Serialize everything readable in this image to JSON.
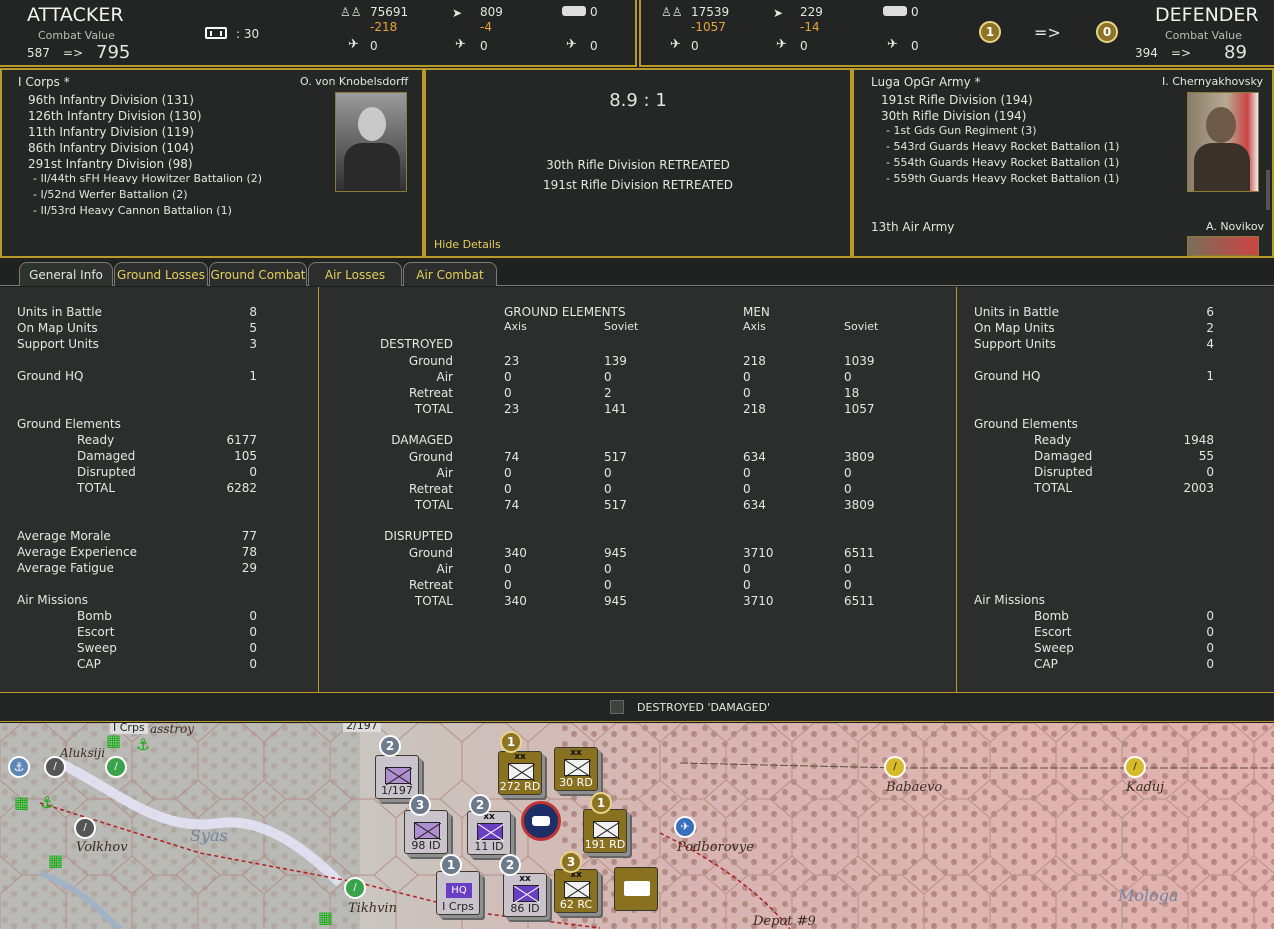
{
  "header": {
    "attacker_title": "ATTACKER",
    "attacker_cv_label": "Combat Value",
    "attacker_cv_from": "587",
    "attacker_cv_arrow": "=>",
    "attacker_cv_to": "795",
    "fort_value": ": 30",
    "att_men": "75691",
    "att_men_loss": "-218",
    "att_guns": "809",
    "att_guns_loss": "-4",
    "att_tanks": "0",
    "att_air1": "0",
    "att_air2": "0",
    "att_air3": "0",
    "def_men": "17539",
    "def_men_loss": "-1057",
    "def_guns": "229",
    "def_guns_loss": "-14",
    "def_tanks": "0",
    "def_air1": "0",
    "def_air2": "0",
    "def_air3": "0",
    "badge_left": "1",
    "badge_arrow": "=>",
    "badge_right": "0",
    "defender_title": "DEFENDER",
    "defender_cv_label": "Combat Value",
    "defender_cv_from": "394",
    "defender_cv_arrow": "=>",
    "defender_cv_to": "89"
  },
  "attacker_units": {
    "hq": "I Corps *",
    "commander": "O. von Knobelsdorff",
    "divisions": [
      "96th Infantry Division (131)",
      "126th Infantry Division (130)",
      "11th Infantry Division (119)",
      "86th Infantry Division (104)",
      "291st Infantry Division (98)"
    ],
    "support": [
      "- II/44th sFH Heavy Howitzer Battalion (2)",
      "- I/52nd Werfer Battalion (2)",
      "- II/53rd Heavy Cannon Battalion (1)"
    ]
  },
  "result": {
    "odds": "8.9 : 1",
    "lines": [
      "30th Rifle Division RETREATED",
      "191st Rifle Division RETREATED"
    ],
    "hide_details": "Hide Details"
  },
  "defender_units": {
    "hq": "Luga OpGr Army *",
    "commander": "I. Chernyakhovsky",
    "divisions": [
      "191st Rifle Division (194)",
      "30th Rifle Division (194)"
    ],
    "support": [
      "- 1st Gds Gun Regiment (3)",
      "- 543rd Guards Heavy Rocket Battalion (1)",
      "- 554th Guards Heavy Rocket Battalion (1)",
      "- 559th Guards Heavy Rocket Battalion (1)"
    ],
    "air_hq": "13th Air Army",
    "air_commander": "A. Novikov"
  },
  "tabs": [
    "General Info",
    "Ground Losses",
    "Ground Combat",
    "Air Losses",
    "Air Combat"
  ],
  "left_stats": [
    {
      "label": "Units in Battle",
      "value": "8",
      "indent": false
    },
    {
      "label": "On Map Units",
      "value": "5",
      "indent": false
    },
    {
      "label": "Support Units",
      "value": "3",
      "indent": false
    },
    {
      "label": "Ground HQ",
      "value": "1",
      "indent": false,
      "gap": true
    },
    {
      "label": "Ground Elements",
      "value": "",
      "indent": false,
      "gap2": true
    },
    {
      "label": "Ready",
      "value": "6177",
      "indent": true
    },
    {
      "label": "Damaged",
      "value": "105",
      "indent": true
    },
    {
      "label": "Disrupted",
      "value": "0",
      "indent": true
    },
    {
      "label": "TOTAL",
      "value": "6282",
      "indent": true
    },
    {
      "label": "Average Morale",
      "value": "77",
      "indent": false,
      "gap2": true
    },
    {
      "label": "Average Experience",
      "value": "78",
      "indent": false
    },
    {
      "label": "Average Fatigue",
      "value": "29",
      "indent": false
    },
    {
      "label": "Air Missions",
      "value": "",
      "indent": false,
      "gap": true
    },
    {
      "label": "Bomb",
      "value": "0",
      "indent": true
    },
    {
      "label": "Escort",
      "value": "0",
      "indent": true
    },
    {
      "label": "Sweep",
      "value": "0",
      "indent": true
    },
    {
      "label": "CAP",
      "value": "0",
      "indent": true
    }
  ],
  "right_stats": [
    {
      "label": "Units in Battle",
      "value": "6",
      "indent": false
    },
    {
      "label": "On Map Units",
      "value": "2",
      "indent": false
    },
    {
      "label": "Support Units",
      "value": "4",
      "indent": false
    },
    {
      "label": "Ground HQ",
      "value": "1",
      "indent": false,
      "gap": true
    },
    {
      "label": "Ground Elements",
      "value": "",
      "indent": false,
      "gap2": true
    },
    {
      "label": "Ready",
      "value": "1948",
      "indent": true
    },
    {
      "label": "Damaged",
      "value": "55",
      "indent": true
    },
    {
      "label": "Disrupted",
      "value": "0",
      "indent": true
    },
    {
      "label": "TOTAL",
      "value": "2003",
      "indent": true
    },
    {
      "label": "Air Missions",
      "value": "",
      "indent": false,
      "gap5": true
    },
    {
      "label": "Bomb",
      "value": "0",
      "indent": true
    },
    {
      "label": "Escort",
      "value": "0",
      "indent": true
    },
    {
      "label": "Sweep",
      "value": "0",
      "indent": true
    },
    {
      "label": "CAP",
      "value": "0",
      "indent": true
    }
  ],
  "center": {
    "ground_elements": "GROUND ELEMENTS",
    "men": "MEN",
    "axis": "Axis",
    "soviet": "Soviet",
    "sections": [
      {
        "title": "DESTROYED",
        "rows": [
          {
            "label": "Ground",
            "v": [
              "23",
              "139",
              "218",
              "1039"
            ]
          },
          {
            "label": "Air",
            "v": [
              "0",
              "0",
              "0",
              "0"
            ]
          },
          {
            "label": "Retreat",
            "v": [
              "0",
              "2",
              "0",
              "18"
            ]
          },
          {
            "label": "TOTAL",
            "v": [
              "23",
              "141",
              "218",
              "1057"
            ]
          }
        ]
      },
      {
        "title": "DAMAGED",
        "rows": [
          {
            "label": "Ground",
            "v": [
              "74",
              "517",
              "634",
              "3809"
            ]
          },
          {
            "label": "Air",
            "v": [
              "0",
              "0",
              "0",
              "0"
            ]
          },
          {
            "label": "Retreat",
            "v": [
              "0",
              "0",
              "0",
              "0"
            ]
          },
          {
            "label": "TOTAL",
            "v": [
              "74",
              "517",
              "634",
              "3809"
            ]
          }
        ]
      },
      {
        "title": "DISRUPTED",
        "rows": [
          {
            "label": "Ground",
            "v": [
              "340",
              "945",
              "3710",
              "6511"
            ]
          },
          {
            "label": "Air",
            "v": [
              "0",
              "0",
              "0",
              "0"
            ]
          },
          {
            "label": "Retreat",
            "v": [
              "0",
              "0",
              "0",
              "0"
            ]
          },
          {
            "label": "TOTAL",
            "v": [
              "340",
              "945",
              "3710",
              "6511"
            ]
          }
        ]
      }
    ]
  },
  "checkbox_label": "DESTROYED 'DAMAGED'",
  "map": {
    "places": [
      "Volkhov",
      "Tikhvin",
      "Podborovye",
      "Babaevo",
      "Kaduj",
      "Depot #9",
      "Syas",
      "Volkhov",
      "Mologa",
      "Aluksiji",
      "I Crps",
      "2/197",
      "asstroy"
    ],
    "counters": [
      {
        "label": "1/197",
        "badge": "2"
      },
      {
        "label": "272 RD",
        "badge": "1"
      },
      {
        "label": "30 RD",
        "badge": ""
      },
      {
        "label": "98 ID",
        "badge": "3"
      },
      {
        "label": "11 ID",
        "badge": "2"
      },
      {
        "label": "191 RD",
        "badge": "1"
      },
      {
        "label": "I Crps",
        "badge": "1",
        "hq": "HQ"
      },
      {
        "label": "86 ID",
        "badge": "2"
      },
      {
        "label": "62 RC",
        "badge": "3"
      }
    ]
  }
}
